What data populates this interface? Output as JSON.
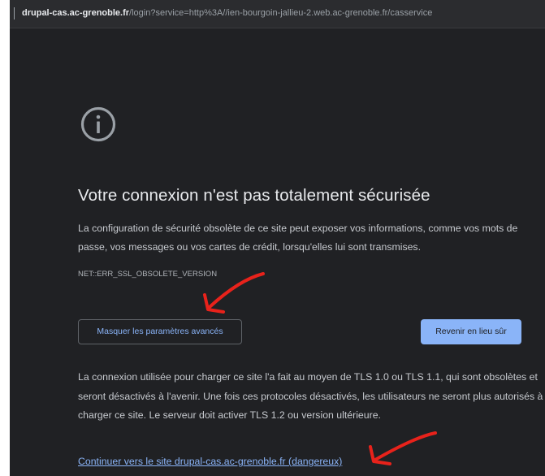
{
  "address_bar": {
    "host": "drupal-cas.ac-grenoble.fr",
    "path": "/login?service=http%3A//ien-bourgoin-jallieu-2.web.ac-grenoble.fr/casservice"
  },
  "interstitial": {
    "icon": "info-circle-icon",
    "title": "Votre connexion n'est pas totalement sécurisée",
    "description": "La configuration de sécurité obsolète de ce site peut exposer vos informations, comme vos mots de passe, vos messages ou vos cartes de crédit, lorsqu'elles lui sont transmises.",
    "error_code": "NET::ERR_SSL_OBSOLETE_VERSION",
    "advanced_button_label": "Masquer les paramètres avancés",
    "back_button_label": "Revenir en lieu sûr",
    "details": "La connexion utilisée pour charger ce site l'a fait au moyen de TLS 1.0 ou TLS 1.1, qui sont obsolètes et seront désactivés à l'avenir. Une fois ces protocoles désactivés, les utilisateurs ne seront plus autorisés à charger ce site. Le serveur doit activer TLS 1.2 ou version ultérieure.",
    "proceed_link": "Continuer vers le site drupal-cas.ac-grenoble.fr (dangereux)"
  },
  "colors": {
    "background": "#202124",
    "link": "#8ab4f8",
    "annotation_arrow": "#e8221b"
  }
}
